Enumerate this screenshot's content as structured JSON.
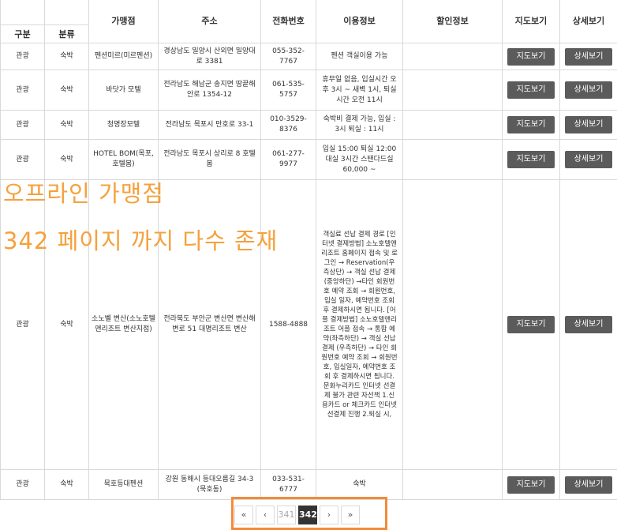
{
  "table": {
    "headers_top": [
      "가맹점",
      "주소",
      "전화번호",
      "이용정보",
      "할인정보",
      "지도보기",
      "상세보기"
    ],
    "headers_sub": [
      "구분",
      "분류"
    ],
    "map_label": "지도보기",
    "detail_label": "상세보기",
    "rows": [
      {
        "type": "관광",
        "cat": "숙박",
        "name": "펜션미르(미르펜션)",
        "addr": "경상남도 밀양시 산외면 밀양대로 3381",
        "phone": "055-352-7767",
        "info": "펜션 객실이용 가능",
        "discount": ""
      },
      {
        "type": "관광",
        "cat": "숙박",
        "name": "바닷가 모텔",
        "addr": "전라남도 해남군 송지면 땅끝해안로 1354-12",
        "phone": "061-535-5757",
        "info": "휴무일 없음, 입실시간 오후 3시 ~ 새벽 1시, 퇴실시간 오전 11시",
        "discount": ""
      },
      {
        "type": "관광",
        "cat": "숙박",
        "name": "청명장모텔",
        "addr": "전라남도 목포시 만호로 33-1",
        "phone": "010-3529-8376",
        "info": "숙박비 결제 가능, 입실 : 3시 퇴실 : 11시",
        "discount": ""
      },
      {
        "type": "관광",
        "cat": "숙박",
        "name": "HOTEL BOM(목포,호텔봄)",
        "addr": "전라남도 목포시 상리로 8 호텔봄",
        "phone": "061-277-9977",
        "info": "입실 15:00 퇴실 12:00 대실 3시간 스탠다드실 60,000 ~",
        "discount": ""
      },
      {
        "type": "관광",
        "cat": "숙박",
        "name": "소노벨 변산(소노호텔앤리조트 변산지점)",
        "addr": "전라북도 부안군 변산면 변산해변로 51 대명리조트 변산",
        "phone": "1588-4888",
        "info": "객실료 선납 결제 경로 [인터넷 결제방법] 소노호텔앤리조트 홈페이지 접속 및 로그인 → Reservation(우측상단) → 객실 선납 결제(중앙하단) →타인 회원번호 예약 조회 → 회원번호, 입실 일자, 예약번호 조회 후 결제하시면 됩니다. [어플 결제방법] 소노호텔앤리조트 어플 접속 → 통합 예약(좌측하단) → 객실 선납 결제 (우측하단) → 타인 회원번호 예약 조회 → 회원번호, 입실일자, 예약번호 조회 후 결제하시면 됩니다. 문화누리카드 인터넷 선결제 불가 관련 자선책 1.신용카드 or 체크카드 인터넷 선결제 진행 2.퇴실 시,",
        "discount": ""
      },
      {
        "type": "관광",
        "cat": "숙박",
        "name": "묵호등대펜션",
        "addr": "강원 동해시 등대오름길 34-3 (묵호동)",
        "phone": "033-531-6777",
        "info": "숙박",
        "discount": ""
      }
    ]
  },
  "overlay": {
    "line1": "오프라인 가맹점",
    "line2": "342 페이지 까지 다수 존재"
  },
  "pager": {
    "first": "«",
    "prev": "‹",
    "pages": [
      "341",
      "342"
    ],
    "current": "342",
    "next": "›",
    "last": "»"
  },
  "colors": {
    "button_bg": "#5b5b5b",
    "overlay_text": "#f5a13c",
    "highlight_border": "#f28b3a",
    "pager_current_bg": "#333333"
  }
}
